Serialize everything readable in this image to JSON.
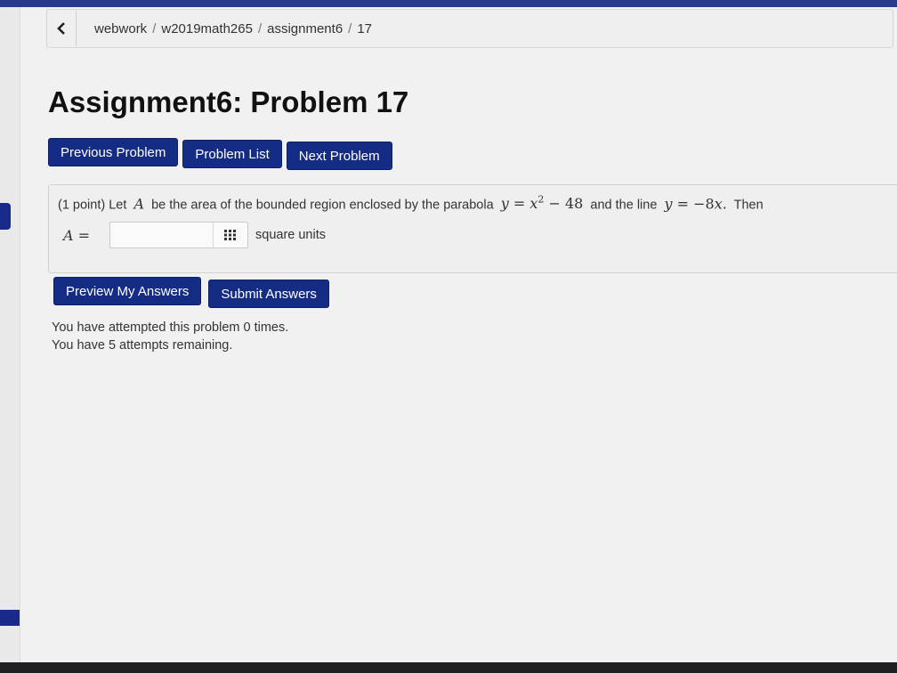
{
  "breadcrumb": {
    "back_icon": "chevron-left-icon",
    "items": [
      "webwork",
      "w2019math265",
      "assignment6",
      "17"
    ],
    "separator": "/"
  },
  "page_title": "Assignment6: Problem 17",
  "nav": {
    "previous": "Previous Problem",
    "list": "Problem List",
    "next": "Next Problem"
  },
  "problem": {
    "points": "(1 point)",
    "t1": "Let",
    "var_A": "A",
    "t2": "be the area of the bounded region enclosed by the parabola",
    "eq1_lhs": "y",
    "eq1_eq": "=",
    "eq1_x": "x",
    "eq1_exp": "2",
    "eq1_rest": "− 48",
    "t3": "and the line",
    "eq2_lhs": "y",
    "eq2_eq": "=",
    "eq2_coef": "−8",
    "eq2_x": "x",
    "eq2_dot": ".",
    "t4": "Then",
    "answer_label": "A =",
    "answer_value": "",
    "units": "square units"
  },
  "actions": {
    "preview": "Preview My Answers",
    "submit": "Submit Answers"
  },
  "attempts": {
    "line1": "You have attempted this problem 0 times.",
    "line2": "You have 5 attempts remaining."
  },
  "colors": {
    "button_bg": "#152c84",
    "page_bg": "#f0f1f0"
  }
}
